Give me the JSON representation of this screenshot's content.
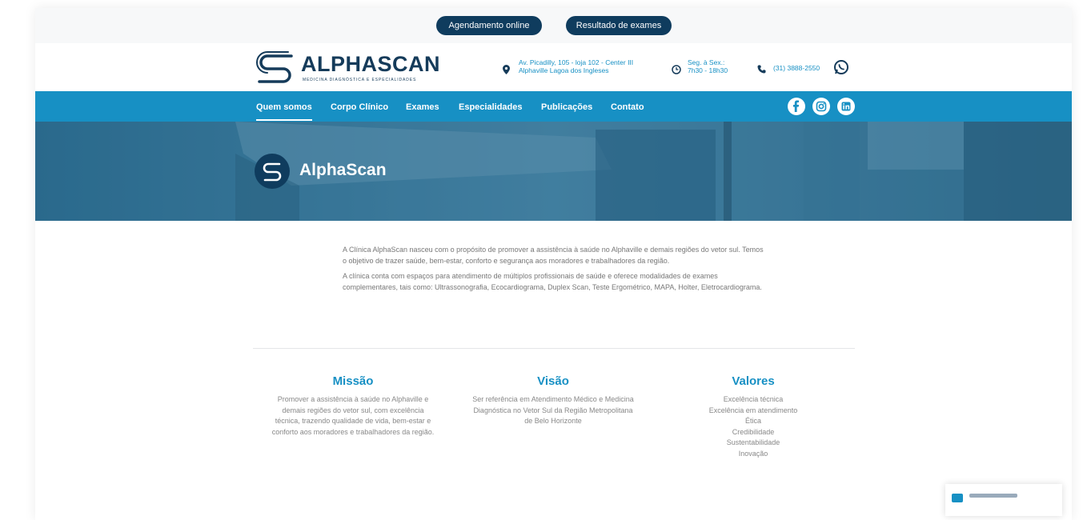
{
  "topbar": {
    "online_booking": "Agendamento online",
    "exam_results": "Resultado de exames"
  },
  "header": {
    "logo_text": "ALPHASCAN",
    "logo_tagline": "MEDICINA DIAGNÓSTICA E ESPECIALIDADES",
    "address_line1": "Av. Picadilly, 105 - loja 102 - Center III",
    "address_line2": "Alphaville Lagoa dos Ingleses",
    "hours_line1": "Seg. à Sex.:",
    "hours_line2": "7h30 - 18h30",
    "phone": "(31) 3888-2550"
  },
  "nav": {
    "items": [
      {
        "label": "Quem somos",
        "active": true
      },
      {
        "label": "Corpo Clínico",
        "active": false
      },
      {
        "label": "Exames",
        "active": false
      },
      {
        "label": "Especialidades",
        "active": false
      },
      {
        "label": "Publicações",
        "active": false
      },
      {
        "label": "Contato",
        "active": false
      }
    ]
  },
  "hero": {
    "title": "AlphaScan"
  },
  "about": {
    "p1": "A Clínica AlphaScan nasceu com o propósito de promover a assistência à saúde no Alphaville e demais regiões do vetor sul. Temos o objetivo de trazer saúde, bem-estar, conforto e segurança aos moradores e trabalhadores da região.",
    "p2": "A clínica conta com espaços para atendimento de múltiplos profissionais de saúde e oferece modalidades de exames complementares, tais como: Ultrassonografia, Ecocardiograma, Duplex Scan, Teste Ergométrico, MAPA, Holter, Eletrocardiograma."
  },
  "missao": {
    "title": "Missão",
    "text": "Promover a assistência à saúde no Alphaville e demais regiões do vetor sul, com excelência técnica, trazendo qualidade de vida, bem-estar e conforto aos moradores e trabalhadores da região."
  },
  "visao": {
    "title": "Visão",
    "text": "Ser referência em Atendimento Médico e Medicina Diagnóstica no Vetor Sul da Região Metropolitana de Belo Horizonte"
  },
  "valores": {
    "title": "Valores",
    "items": [
      "Excelência técnica",
      "Excelência em atendimento",
      "Ética",
      "Credibilidade",
      "Sustentabilidade",
      "Inovação"
    ]
  },
  "colors": {
    "brand_dark": "#0f3c5e",
    "brand_blue": "#1790c4"
  }
}
